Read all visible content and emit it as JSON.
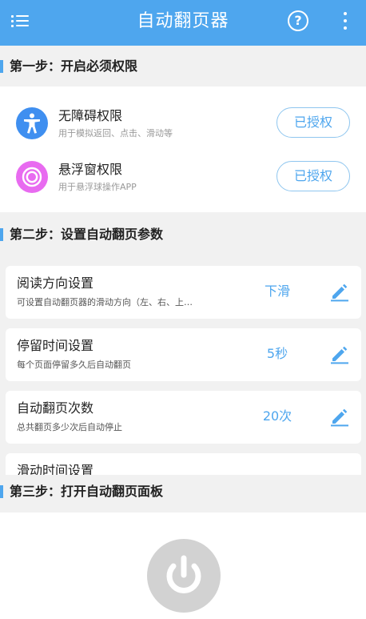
{
  "header": {
    "title": "自动翻页器",
    "help_label": "?",
    "bg_color": "#4ea6ee"
  },
  "steps": {
    "step1": "第一步：开启必须权限",
    "step2": "第二步：设置自动翻页参数",
    "step3": "第三步：打开自动翻页面板"
  },
  "permissions": [
    {
      "title": "无障碍权限",
      "subtitle": "用于模拟返回、点击、滑动等",
      "button": "已授权",
      "icon": "accessibility-icon",
      "icon_color": "#3f8ff0"
    },
    {
      "title": "悬浮窗权限",
      "subtitle": "用于悬浮球操作APP",
      "button": "已授权",
      "icon": "floating-ball-icon",
      "icon_color": "#e86bf0"
    }
  ],
  "settings": [
    {
      "title": "阅读方向设置",
      "subtitle": "可设置自动翻页器的滑动方向（左、右、上…",
      "value": "下滑"
    },
    {
      "title": "停留时间设置",
      "subtitle": "每个页面停留多久后自动翻页",
      "value": "5秒"
    },
    {
      "title": "自动翻页次数",
      "subtitle": "总共翻页多少次后自动停止",
      "value": "20次"
    },
    {
      "title": "滑动时间设置"
    }
  ],
  "power": {
    "icon": "power-icon",
    "state_color": "#d2d2d2"
  }
}
